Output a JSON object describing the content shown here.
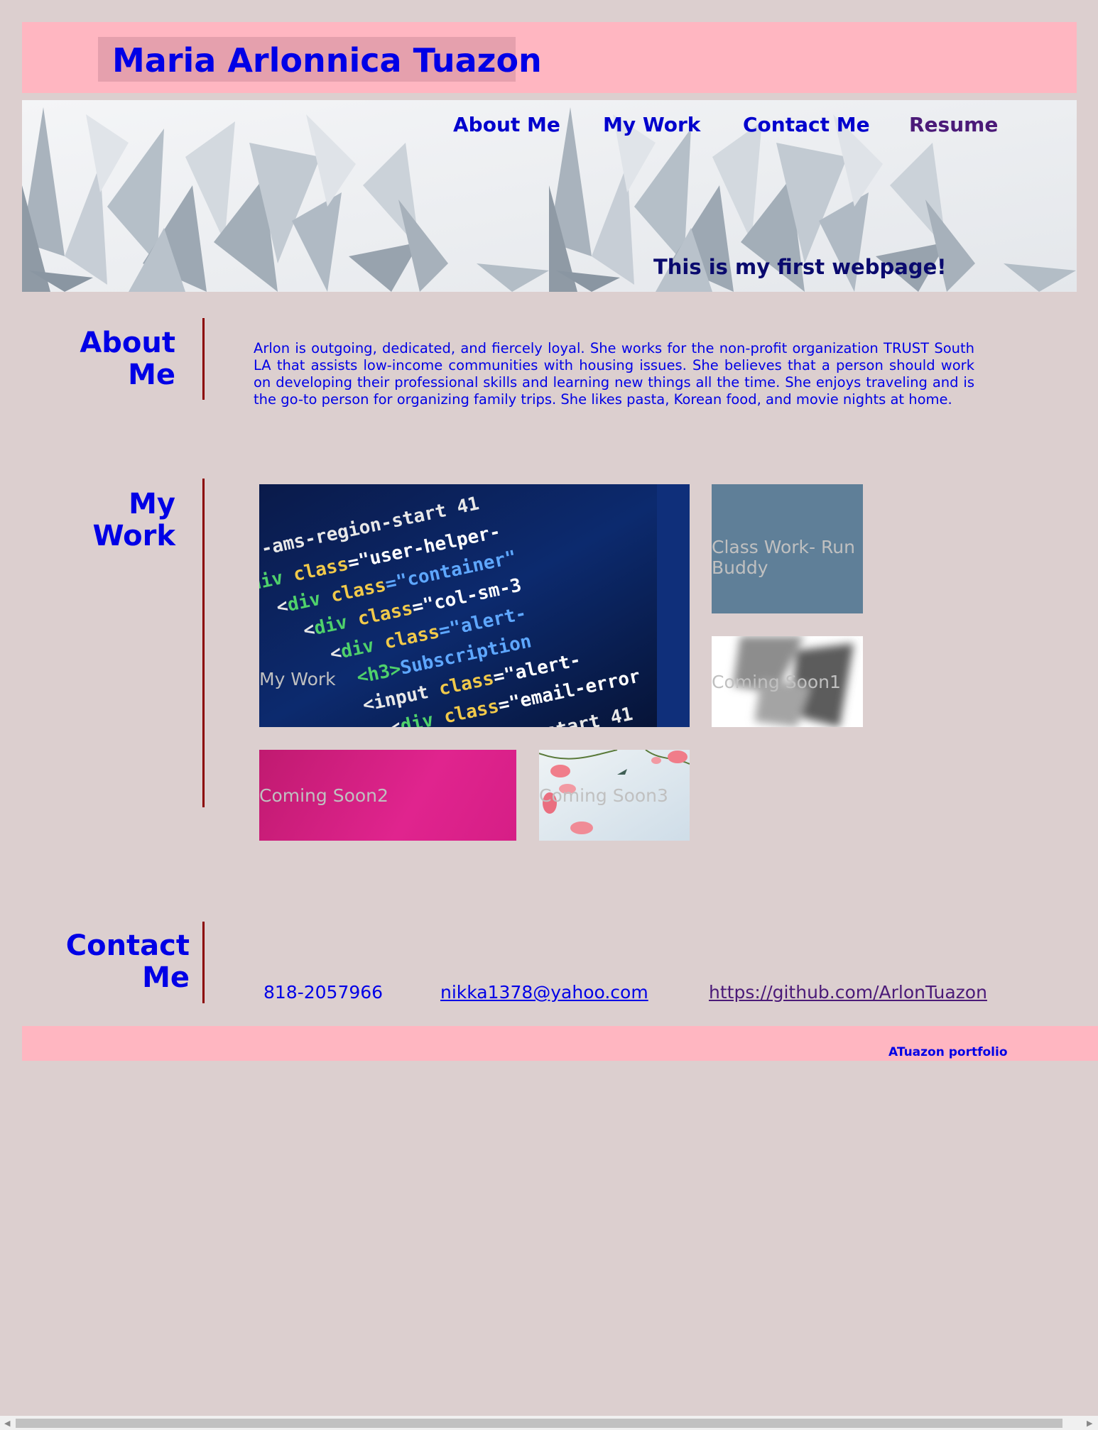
{
  "header": {
    "title": "Maria Arlonnica Tuazon"
  },
  "nav": [
    {
      "label": "About Me"
    },
    {
      "label": "My Work"
    },
    {
      "label": "Contact Me"
    },
    {
      "label": "Resume"
    }
  ],
  "hero": {
    "tagline": "This is my first webpage!"
  },
  "about": {
    "title_line1": "About",
    "title_line2": "Me",
    "text": "Arlon is outgoing, dedicated, and fiercely loyal. She works for the non-profit organization TRUST South LA that assists low-income communities with housing issues. She believes that a person should work on developing their professional skills and learning new things all the time. She enjoys traveling and is the go-to person for organizing family trips. She likes pasta, Korean food, and movie nights at home."
  },
  "work": {
    "title_line1": "My",
    "title_line2": "Work",
    "tiles": [
      {
        "label": "My Work"
      },
      {
        "label": "Class Work- Run Buddy"
      },
      {
        "label": "Coming Soon1"
      },
      {
        "label": "Coming Soon2"
      },
      {
        "label": "Coming Soon3"
      }
    ]
  },
  "contact": {
    "title_line1": "Contact",
    "title_line2": "Me",
    "phone": "818-2057966",
    "email": "nikka1378@yahoo.com",
    "github": "https://github.com/ArlonTuazon"
  },
  "footer": {
    "text": "ATuazon portfolio"
  },
  "colors": {
    "page_bg": "#dccfcf",
    "header_bg": "#ffb6c1",
    "heading_blue": "#0000e6",
    "divider": "#8b0000",
    "visited_link": "#4b1a78"
  }
}
